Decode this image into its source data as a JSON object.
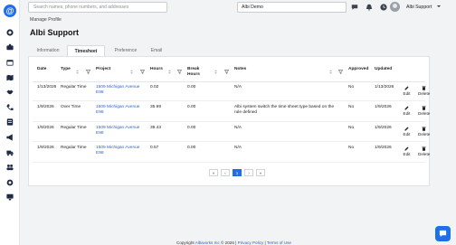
{
  "search": {
    "placeholder": "Search names, phone numbers, and addresses"
  },
  "company": {
    "name": "Albi Demo"
  },
  "user": {
    "name": "Albi Support"
  },
  "sidebar": {
    "logo": "@",
    "icons": [
      "dashboard-icon",
      "briefcase-icon",
      "calendar-icon",
      "map-icon",
      "handshake-icon",
      "phone-icon",
      "invoice-icon",
      "megaphone-icon",
      "truck-icon",
      "team-icon",
      "settings-icon",
      "monitor-icon"
    ]
  },
  "breadcrumb": "Manage Profile",
  "page_title": "Albi Support",
  "tabs": [
    "Information",
    "Timesheet",
    "Preference",
    "Email"
  ],
  "active_tab": "Timesheet",
  "table": {
    "headers": {
      "date": "Date",
      "type": "Type",
      "project": "Project",
      "hours": "Hours",
      "break_hours_1": "Break",
      "break_hours_2": "Hours",
      "notes": "Notes",
      "approved": "Approved",
      "updated": "Updated"
    },
    "rows": [
      {
        "date": "1/13/2026",
        "type": "Regular Time",
        "project_1": "1509 Michigan Avenue",
        "project_2": "E98",
        "hours": "0.02",
        "break": "0.00",
        "notes_1": "N/A",
        "notes_2": "",
        "approved": "No",
        "updated": "1/13/2026"
      },
      {
        "date": "1/9/2026",
        "type": "Over Time",
        "project_1": "1509 Michigan Avenue",
        "project_2": "E98",
        "hours": "35.99",
        "break": "0.00",
        "notes_1": "Albi system switch the time sheet type based on the",
        "notes_2": "rule defined",
        "approved": "No",
        "updated": "1/9/2026"
      },
      {
        "date": "1/9/2026",
        "type": "Regular Time",
        "project_1": "1509 Michigan Avenue",
        "project_2": "E98",
        "hours": "39.43",
        "break": "0.00",
        "notes_1": "N/A",
        "notes_2": "",
        "approved": "No",
        "updated": "1/9/2026"
      },
      {
        "date": "1/9/2026",
        "type": "Regular Time",
        "project_1": "1509 Michigan Avenue",
        "project_2": "E98",
        "hours": "0.57",
        "break": "0.00",
        "notes_1": "N/A",
        "notes_2": "",
        "approved": "No",
        "updated": "1/9/2026"
      }
    ],
    "actions": {
      "edit": "Edit",
      "delete": "Delete"
    }
  },
  "pagination": {
    "first": "«",
    "prev": "‹",
    "current": "1",
    "next": "›",
    "last": "»"
  },
  "footer": {
    "copyright": "Copyright ",
    "brand": "Albiworks Inc",
    "year": " © 2026 | ",
    "privacy": "Privacy Policy",
    "sep": " | ",
    "terms": "Terms of Use"
  },
  "colors": {
    "accent": "#1f6feb",
    "link": "#2d64c8"
  }
}
